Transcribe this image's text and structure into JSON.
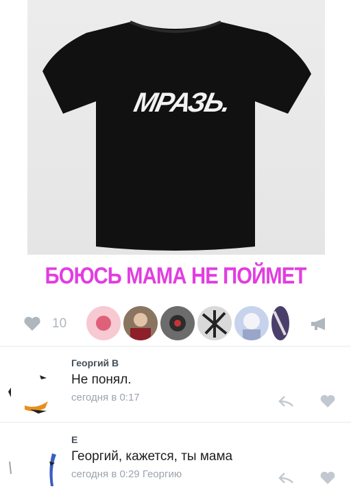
{
  "post": {
    "shirt_print": "МРАЗЬ.",
    "caption": "БОЮСЬ МАМА НЕ ПОЙМЕТ"
  },
  "actions": {
    "like_count": "10",
    "like_icon": "heart-icon",
    "share_icon": "megaphone-icon",
    "liker_avatars": 6
  },
  "comments": [
    {
      "author": "Георгий В",
      "text": "Не понял.",
      "meta": "сегодня в 0:17"
    },
    {
      "author": "Е",
      "text": "Георгий, кажется, ты мама",
      "meta": "сегодня в 0:29 Георгию"
    }
  ],
  "colors": {
    "caption": "#e23de0",
    "icon": "#aeb6be",
    "meta": "#9aa3ad"
  }
}
